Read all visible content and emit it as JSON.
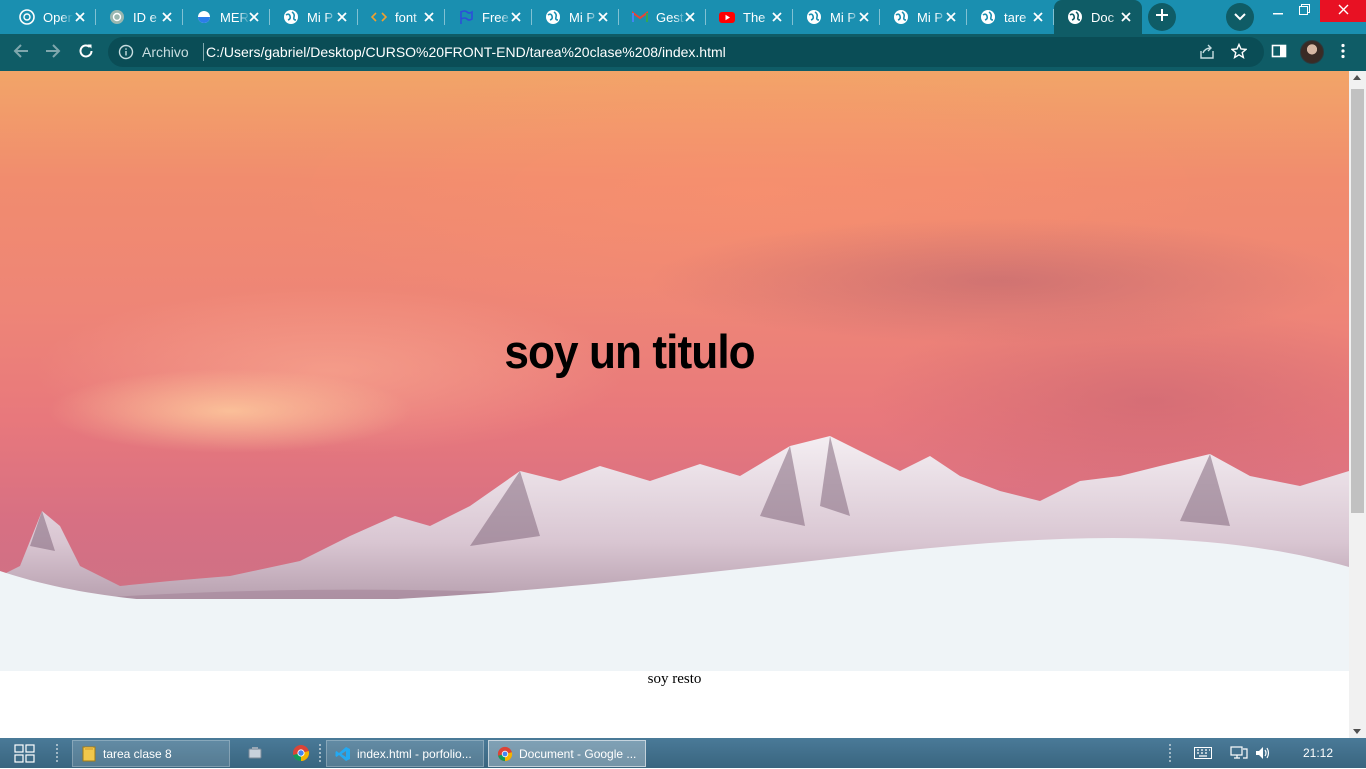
{
  "browser": {
    "tabs": [
      {
        "title": "Open",
        "icon": "openai-icon"
      },
      {
        "title": "ID e",
        "icon": "chatgpt-icon"
      },
      {
        "title": "MER",
        "icon": "blue-circle-icon"
      },
      {
        "title": "Mi P",
        "icon": "globe-icon"
      },
      {
        "title": "font",
        "icon": "code-icon"
      },
      {
        "title": "Free",
        "icon": "flag-icon"
      },
      {
        "title": "Mi P",
        "icon": "globe-icon"
      },
      {
        "title": "Gest",
        "icon": "gmail-icon"
      },
      {
        "title": "The",
        "icon": "youtube-icon"
      },
      {
        "title": "Mi P",
        "icon": "globe-icon"
      },
      {
        "title": "Mi P",
        "icon": "globe-icon"
      },
      {
        "title": "tare",
        "icon": "globe-icon"
      },
      {
        "title": "Doc",
        "icon": "globe-icon",
        "active": true
      }
    ],
    "address_bar": {
      "scheme_label": "Archivo",
      "url": "C:/Users/gabriel/Desktop/CURSO%20FRONT-END/tarea%20clase%208/index.html"
    }
  },
  "page": {
    "hero_title": "soy un titulo",
    "rest_text": "soy resto"
  },
  "taskbar": {
    "windows": [
      {
        "label": "tarea clase 8",
        "icon": "folder-icon"
      },
      {
        "label": "index.html - porfolio...",
        "icon": "vscode-icon"
      },
      {
        "label": "Document - Google ...",
        "icon": "chrome-icon",
        "active": true
      }
    ],
    "clock": "21:12"
  },
  "colors": {
    "tabstrip": "#1a8fb0",
    "toolbar": "#0f5c66",
    "band": "#eff4f7"
  }
}
